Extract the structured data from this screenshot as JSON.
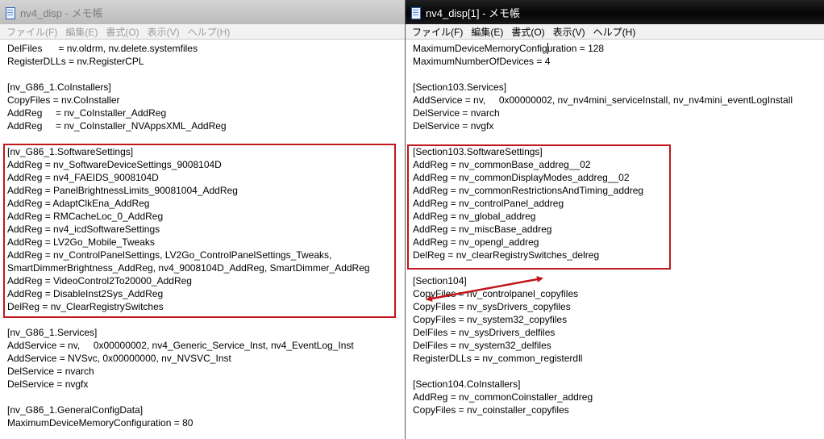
{
  "left_window": {
    "title": "nv4_disp - メモ帳",
    "menu": [
      "ファイル(F)",
      "編集(E)",
      "書式(O)",
      "表示(V)",
      "ヘルプ(H)"
    ],
    "lines": [
      "DelFiles      = nv.oldrm, nv.delete.systemfiles",
      "RegisterDLLs = nv.RegisterCPL",
      "",
      "[nv_G86_1.CoInstallers]",
      "CopyFiles = nv.CoInstaller",
      "AddReg     = nv_CoInstaller_AddReg",
      "AddReg     = nv_CoInstaller_NVAppsXML_AddReg",
      "",
      "[nv_G86_1.SoftwareSettings]",
      "AddReg = nv_SoftwareDeviceSettings_9008104D",
      "AddReg = nv4_FAEIDS_9008104D",
      "AddReg = PanelBrightnessLimits_90081004_AddReg",
      "AddReg = AdaptClkEna_AddReg",
      "AddReg = RMCacheLoc_0_AddReg",
      "AddReg = nv4_icdSoftwareSettings",
      "AddReg = LV2Go_Mobile_Tweaks",
      "AddReg = nv_ControlPanelSettings, LV2Go_ControlPanelSettings_Tweaks,",
      "SmartDimmerBrightness_AddReg, nv4_9008104D_AddReg, SmartDimmer_AddReg",
      "AddReg = VideoControl2To20000_AddReg",
      "AddReg = DisableInst2Sys_AddReg",
      "DelReg = nv_ClearRegistrySwitches",
      "",
      "[nv_G86_1.Services]",
      "AddService = nv,     0x00000002, nv4_Generic_Service_Inst, nv4_EventLog_Inst",
      "AddService = NVSvc, 0x00000000, nv_NVSVC_Inst",
      "DelService = nvarch",
      "DelService = nvgfx",
      "",
      "[nv_G86_1.GeneralConfigData]",
      "MaximumDeviceMemoryConfiguration = 80"
    ]
  },
  "right_window": {
    "title": "nv4_disp[1] - メモ帳",
    "menu": [
      "ファイル(F)",
      "編集(E)",
      "書式(O)",
      "表示(V)",
      "ヘルプ(H)"
    ],
    "lines": [
      "MaximumDeviceMemoryConfiguration = 128",
      "MaximumNumberOfDevices = 4",
      "",
      "[Section103.Services]",
      "AddService = nv,     0x00000002, nv_nv4mini_serviceInstall, nv_nv4mini_eventLogInstall",
      "DelService = nvarch",
      "DelService = nvgfx",
      "",
      "[Section103.SoftwareSettings]",
      "AddReg = nv_commonBase_addreg__02",
      "AddReg = nv_commonDisplayModes_addreg__02",
      "AddReg = nv_commonRestrictionsAndTiming_addreg",
      "AddReg = nv_controlPanel_addreg",
      "AddReg = nv_global_addreg",
      "AddReg = nv_miscBase_addreg",
      "AddReg = nv_opengl_addreg",
      "DelReg = nv_clearRegistrySwitches_delreg",
      "",
      "[Section104]",
      "CopyFiles = nv_controlpanel_copyfiles",
      "CopyFiles = nv_sysDrivers_copyfiles",
      "CopyFiles = nv_system32_copyfiles",
      "DelFiles = nv_sysDrivers_delfiles",
      "DelFiles = nv_system32_delfiles",
      "RegisterDLLs = nv_common_registerdll",
      "",
      "[Section104.CoInstallers]",
      "AddReg = nv_commonCoinstaller_addreg",
      "CopyFiles = nv_coinstaller_copyfiles"
    ]
  },
  "annotation": {
    "highlight_color": "#c0161c",
    "left_highlight_lines": "8-20",
    "right_highlight_lines": "8-16"
  }
}
